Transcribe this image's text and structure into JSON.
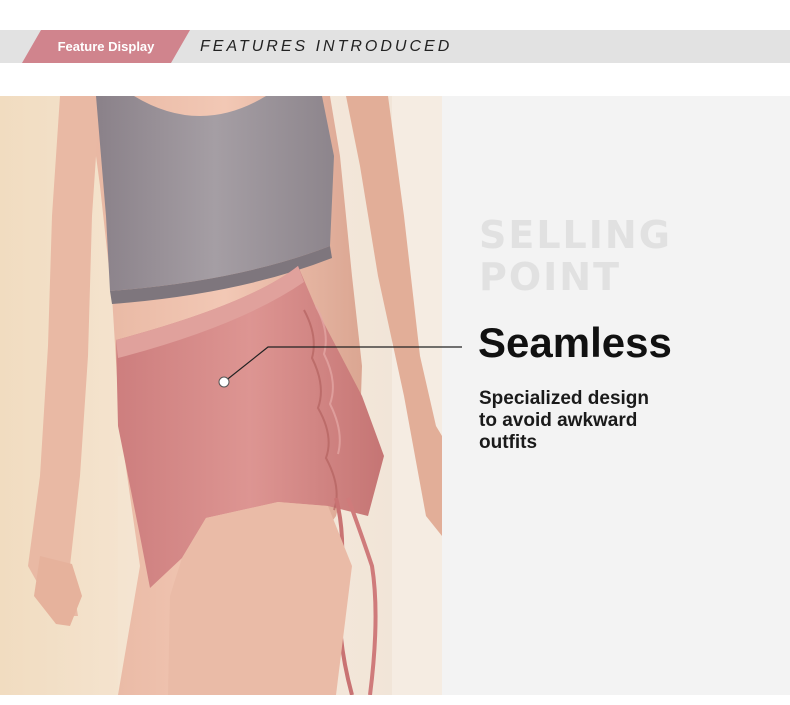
{
  "header": {
    "tab_label": "Feature Display",
    "title": "FEATURES INTRODUCED"
  },
  "selling_point": {
    "watermark_line1": "SELLING",
    "watermark_line2": "POINT",
    "headline": "Seamless",
    "description_lines": [
      "Specialized design",
      "to avoid awkward",
      "outfits"
    ]
  },
  "colors": {
    "accent": "#d0848d",
    "header_bar": "#e2e2e2",
    "panel_bg": "#f3f3f3",
    "watermark": "#e1e1e1"
  }
}
